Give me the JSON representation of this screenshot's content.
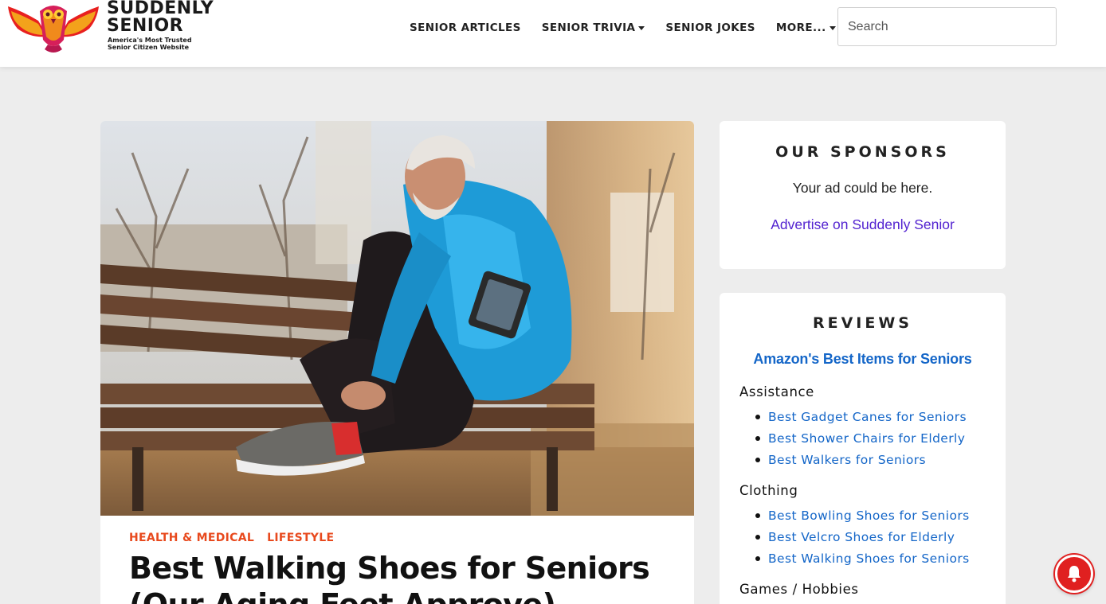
{
  "header": {
    "logo": {
      "line1": "SUDDENLY",
      "line2": "SENIOR",
      "tagline1": "America's Most Trusted",
      "tagline2": "Senior Citizen Website"
    },
    "nav": [
      {
        "label": "SENIOR ARTICLES",
        "dropdown": false
      },
      {
        "label": "SENIOR TRIVIA",
        "dropdown": true
      },
      {
        "label": "SENIOR JOKES",
        "dropdown": false
      },
      {
        "label": "MORE...",
        "dropdown": true
      }
    ],
    "search": {
      "placeholder": "Search",
      "value": ""
    }
  },
  "article": {
    "image_icon": "hero-photo-senior-tying-shoe",
    "categories": [
      "HEALTH & MEDICAL",
      "LIFESTYLE"
    ],
    "title": "Best Walking Shoes for Seniors (Our Aging Feet Approve)"
  },
  "sidebar": {
    "sponsors": {
      "title": "OUR SPONSORS",
      "text": "Your ad could be here.",
      "link": "Advertise on Suddenly Senior"
    },
    "reviews": {
      "title": "REVIEWS",
      "amazon_link": "Amazon's Best Items for Seniors",
      "groups": [
        {
          "heading": "Assistance",
          "items": [
            "Best Gadget Canes for Seniors",
            "Best Shower Chairs for Elderly",
            "Best Walkers for Seniors"
          ]
        },
        {
          "heading": "Clothing",
          "items": [
            "Best Bowling Shoes for Seniors",
            "Best Velcro Shoes for Elderly",
            "Best Walking Shoes for Seniors"
          ]
        },
        {
          "heading": "Games / Hobbies",
          "items": []
        }
      ]
    }
  },
  "colors": {
    "category": "#e8491d",
    "link_blue": "#1466c8",
    "sponsor_link": "#5222d0",
    "notification": "#e02020"
  },
  "notification": {
    "icon": "bell-icon"
  }
}
